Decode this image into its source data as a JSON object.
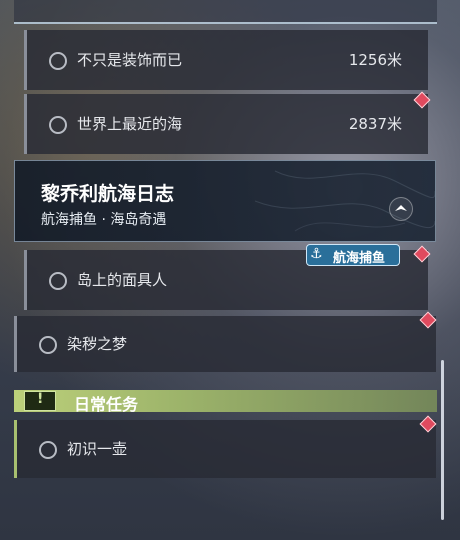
{
  "quests": [
    {
      "title": "不只是装饰而已",
      "distance": "1256米"
    },
    {
      "title": "世界上最近的海",
      "distance": "2837米"
    },
    {
      "title": "岛上的面具人",
      "distance": ""
    },
    {
      "title": "染秽之梦",
      "distance": ""
    },
    {
      "title": "初识一壶",
      "distance": ""
    }
  ],
  "header": {
    "title": "黎乔利航海日志",
    "subtitle": "航海捕鱼 · 海岛奇遇"
  },
  "tag": {
    "label": "航海捕鱼"
  },
  "daily": {
    "label": "日常任务"
  },
  "colors": {
    "marker": "#e04a5e",
    "daily_accent": "#bcd07a",
    "tag_bg": "#2a6f9a"
  }
}
